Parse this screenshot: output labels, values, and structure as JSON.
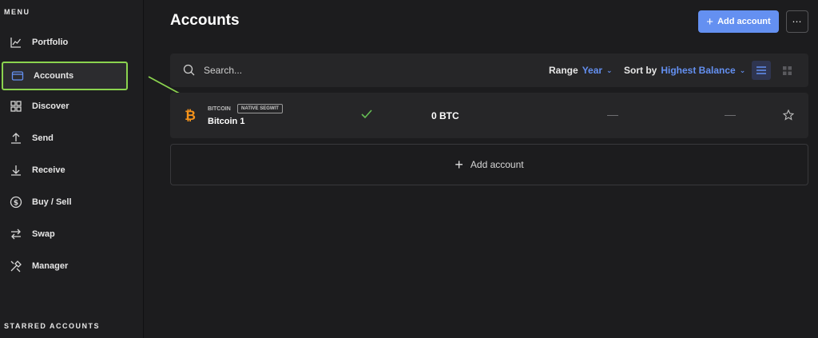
{
  "sidebar": {
    "menu_title": "MENU",
    "items": [
      {
        "label": "Portfolio",
        "icon": "chart-icon"
      },
      {
        "label": "Accounts",
        "icon": "wallet-icon"
      },
      {
        "label": "Discover",
        "icon": "grid-icon"
      },
      {
        "label": "Send",
        "icon": "upload-arrow-icon"
      },
      {
        "label": "Receive",
        "icon": "download-arrow-icon"
      },
      {
        "label": "Buy / Sell",
        "icon": "dollar-circle-icon"
      },
      {
        "label": "Swap",
        "icon": "swap-icon"
      },
      {
        "label": "Manager",
        "icon": "tools-icon"
      }
    ],
    "starred_title": "STARRED ACCOUNTS"
  },
  "header": {
    "title": "Accounts",
    "add_account_label": "Add account",
    "more_label": "⋯"
  },
  "toolbar": {
    "search_placeholder": "Search...",
    "range_label": "Range",
    "range_value": "Year",
    "sort_label": "Sort by",
    "sort_value": "Highest Balance"
  },
  "accounts": [
    {
      "currency": "BITCOIN",
      "badge": "NATIVE SEGWIT",
      "name": "Bitcoin 1",
      "balance": "0 BTC",
      "countervalue": "—",
      "variation": "—"
    }
  ],
  "add_account_row_label": "Add account",
  "colors": {
    "accent": "#6490f1",
    "highlight": "#8bd34f",
    "bitcoin": "#f7931a",
    "success": "#66be54"
  }
}
